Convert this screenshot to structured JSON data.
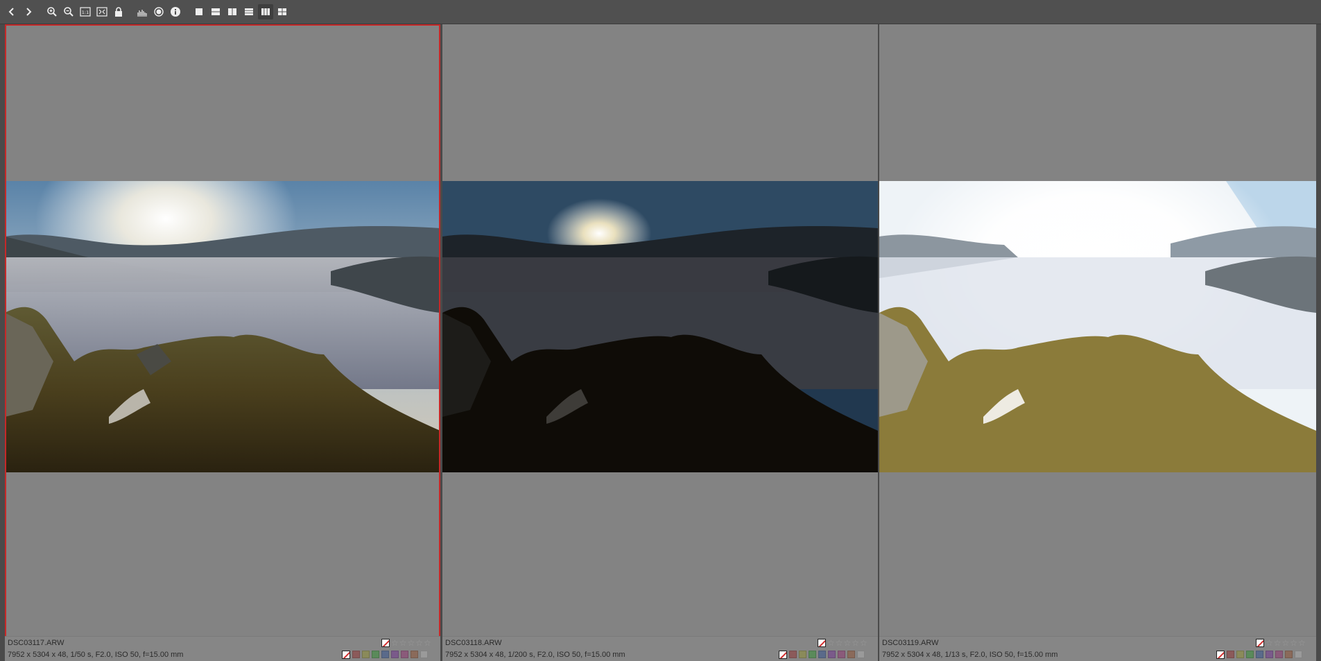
{
  "toolbar": {
    "buttons": [
      {
        "name": "prev-button",
        "icon": "chevron-left-icon"
      },
      {
        "name": "next-button",
        "icon": "chevron-right-icon"
      },
      {
        "name": "zoom-in-button",
        "icon": "zoom-in-icon"
      },
      {
        "name": "zoom-out-button",
        "icon": "zoom-out-icon"
      },
      {
        "name": "zoom-100-button",
        "icon": "one-to-one-icon",
        "label": "1:1"
      },
      {
        "name": "fit-button",
        "icon": "fit-screen-icon"
      },
      {
        "name": "lock-button",
        "icon": "lock-icon"
      },
      {
        "name": "histogram-button",
        "icon": "histogram-icon"
      },
      {
        "name": "focus-button",
        "icon": "focus-icon"
      },
      {
        "name": "info-button",
        "icon": "info-icon"
      },
      {
        "name": "layout-single-button",
        "icon": "layout-single-icon"
      },
      {
        "name": "layout-2-horizontal-button",
        "icon": "layout-2h-icon"
      },
      {
        "name": "layout-2-vertical-button",
        "icon": "layout-2v-icon"
      },
      {
        "name": "layout-3-horizontal-button",
        "icon": "layout-3h-icon"
      },
      {
        "name": "layout-3-vertical-button",
        "icon": "layout-3v-icon"
      },
      {
        "name": "layout-grid-button",
        "icon": "layout-grid-icon"
      }
    ],
    "active_layout": "layout-3-vertical-button"
  },
  "panes": [
    {
      "filename": "DSC03117.ARW",
      "meta": "7952 x 5304 x 48, 1/50 s, F2.0, ISO 50, f=15.00 mm",
      "selected": true,
      "stars": "☆☆☆☆☆",
      "exposure": "normal"
    },
    {
      "filename": "DSC03118.ARW",
      "meta": "7952 x 5304 x 48, 1/200 s, F2.0, ISO 50, f=15.00 mm",
      "selected": false,
      "stars": "☆☆☆☆☆",
      "exposure": "dark"
    },
    {
      "filename": "DSC03119.ARW",
      "meta": "7952 x 5304 x 48, 1/13 s, F2.0, ISO 50, f=15.00 mm",
      "selected": false,
      "stars": "☆☆☆☆☆",
      "exposure": "bright"
    }
  ],
  "colors": {
    "selection_border": "#c62828",
    "pane_background": "#838383",
    "label_swatches": [
      "#8b5a5a",
      "#8a8a5a",
      "#5a8a5a",
      "#5a6a8a",
      "#7a5a8a",
      "#8a5a7a",
      "#8a6a5a",
      "#9a9a9a",
      "#6a6a6a"
    ]
  }
}
